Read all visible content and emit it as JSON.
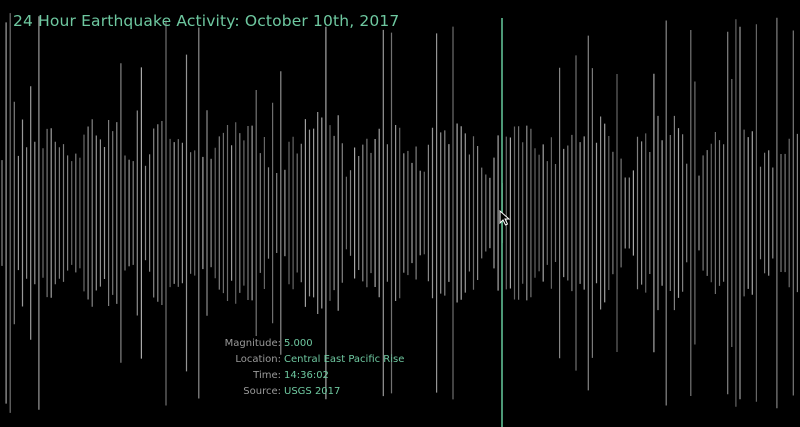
{
  "title": "24 Hour Earthquake Activity: October 10th, 2017",
  "info": {
    "magnitude_label": "Magnitude:",
    "magnitude_value": "5.000",
    "location_label": "Location:",
    "location_value": "Central East Pacific Rise",
    "time_label": "Time:",
    "time_value": "14:36:02",
    "source_label": "Source:",
    "source_value": "USGS 2017"
  },
  "colors": {
    "background": "#000000",
    "accent": "#6ec8a0",
    "wave": "#b4b4b4",
    "label": "#9a9a9a"
  },
  "icons": {
    "cursor": "mouse-pointer-icon"
  }
}
